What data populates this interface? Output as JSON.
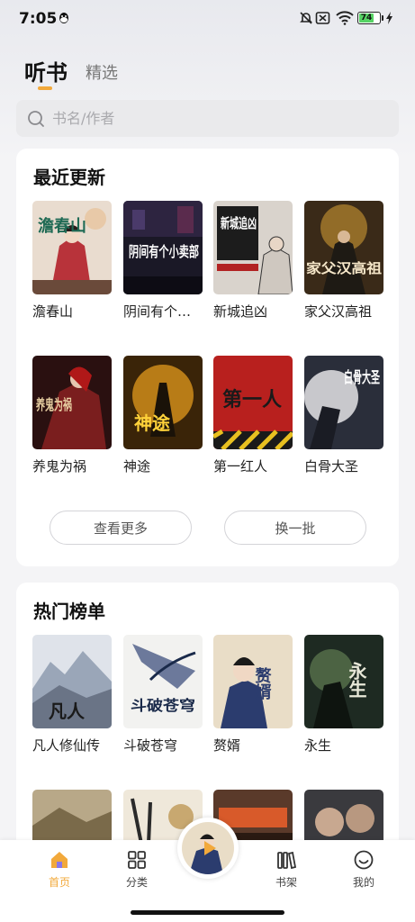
{
  "status_bar": {
    "time": "7:05",
    "battery": "74",
    "battery_level": 0.74
  },
  "tabs": {
    "active": "听书",
    "inactive": "精选"
  },
  "search": {
    "placeholder": "书名/作者"
  },
  "recent": {
    "title": "最近更新",
    "books": [
      {
        "title": "澹春山",
        "cover_text": "澹春山"
      },
      {
        "title": "阴间有个小卖部",
        "cover_text": "阴间有个小卖部"
      },
      {
        "title": "新城追凶",
        "cover_text": "新城追凶"
      },
      {
        "title": "家父汉高祖",
        "cover_text": "家父汉高祖"
      },
      {
        "title": "养鬼为祸",
        "cover_text": "养鬼为祸"
      },
      {
        "title": "神途",
        "cover_text": "神途"
      },
      {
        "title": "第一红人",
        "cover_text": "第一人"
      },
      {
        "title": "白骨大圣",
        "cover_text": "白骨大圣"
      }
    ],
    "more_button": "查看更多",
    "refresh_button": "换一批"
  },
  "hot": {
    "title": "热门榜单",
    "books": [
      {
        "title": "凡人修仙传",
        "cover_text": "凡人"
      },
      {
        "title": "斗破苍穹",
        "cover_text": "斗破苍穹"
      },
      {
        "title": "赘婿",
        "cover_text": "赘婿"
      },
      {
        "title": "永生",
        "cover_text": "永生"
      }
    ]
  },
  "bottom_nav": [
    {
      "label": "首页",
      "icon": "home-icon",
      "active": true
    },
    {
      "label": "分类",
      "icon": "category-icon",
      "active": false
    },
    {
      "label": "书架",
      "icon": "bookshelf-icon",
      "active": false
    },
    {
      "label": "我的",
      "icon": "profile-icon",
      "active": false
    }
  ],
  "colors": {
    "accent": "#f2a93b",
    "card": "#ffffff",
    "background": "#f4f4f6"
  }
}
